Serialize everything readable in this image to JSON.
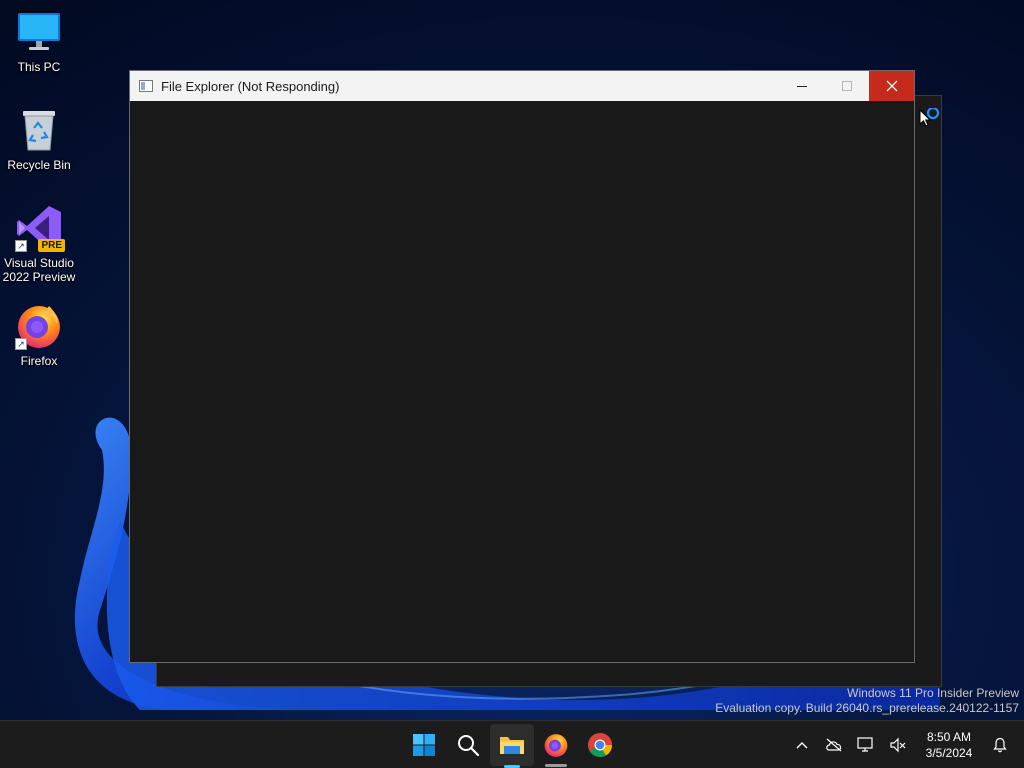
{
  "desktop": {
    "icons": [
      {
        "label": "This PC",
        "icon": "monitor-icon"
      },
      {
        "label": "Recycle Bin",
        "icon": "recycle-bin-icon"
      },
      {
        "label_line1": "Visual Studio",
        "label_line2": "2022 Preview",
        "badge": "PRE",
        "icon": "visual-studio-icon"
      },
      {
        "label": "Firefox",
        "icon": "firefox-icon"
      }
    ]
  },
  "window": {
    "title": "File Explorer (Not Responding)",
    "controls": {
      "minimize": "minimize-icon",
      "maximize": "maximize-icon",
      "close": "close-icon"
    }
  },
  "watermark": {
    "line1": "Windows 11 Pro Insider Preview",
    "line2": "Evaluation copy. Build 26040.rs_prerelease.240122-1157"
  },
  "taskbar": {
    "pinned": [
      {
        "name": "start",
        "icon": "windows-start-icon"
      },
      {
        "name": "search",
        "icon": "search-icon"
      },
      {
        "name": "file-explorer",
        "icon": "folder-icon",
        "active": true
      },
      {
        "name": "firefox",
        "icon": "firefox-icon",
        "running": true
      },
      {
        "name": "chrome",
        "icon": "chrome-icon"
      }
    ],
    "tray": {
      "time": "8:50 AM",
      "date": "3/5/2024"
    }
  },
  "colors": {
    "close_button": "#c42b1c",
    "accent": "#4cc2ff",
    "window_body": "#191919",
    "taskbar": "#1c1c1c"
  }
}
